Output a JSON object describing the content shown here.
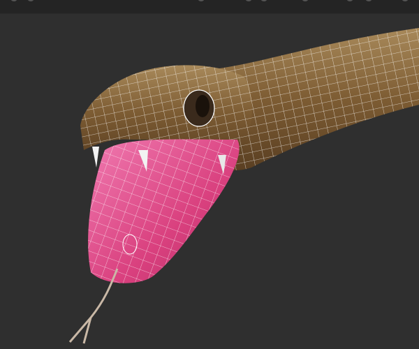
{
  "viewport": {
    "background_color": "#2f2f2f",
    "toolbar_color": "#242424",
    "model": {
      "skin_color": "#8a6a3e",
      "mouth_color": "#e0508c",
      "wireframe_color": "#ffffff"
    }
  }
}
